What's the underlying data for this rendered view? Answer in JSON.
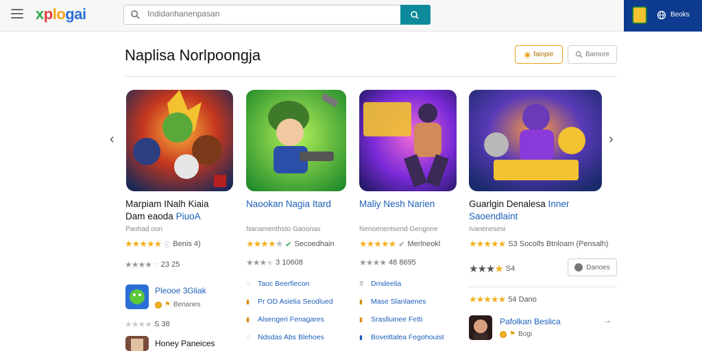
{
  "header": {
    "logo_parts": [
      "x",
      "p",
      "lo",
      "gai"
    ],
    "search_placeholder": "Indidanhanenpasan",
    "account_label": "Beoks"
  },
  "page": {
    "title": "Naplisa Norlpoongja",
    "primary_button": "fainpie",
    "secondary_button": "Bamore"
  },
  "cards": [
    {
      "title_line1": "Marpiam INalh Kiaia",
      "title_line2": "Dam eaoda",
      "title_line2_link": "PiuoA",
      "subtitle": "Paohad oon",
      "rating_text": "Benis 4)",
      "secondary_rating": "23 25",
      "colors": {
        "title": "#111111"
      }
    },
    {
      "title_line1": "Naookan Nagia Itard",
      "subtitle": "Nanamenthsto Gaoonas",
      "rating_text": "Secoedhain",
      "secondary_rating": "3 10608",
      "colors": {
        "title": "#1c5fb8"
      }
    },
    {
      "title_line1": "Maliy Nesh Narien",
      "subtitle": "Nenoenentsend Gengone",
      "rating_text": "Merlneokl",
      "secondary_rating": "48 8695",
      "colors": {
        "title": "#1c5fb8"
      }
    },
    {
      "title_line1": "Guarlgin Denalesa",
      "title_line1_link": "Inner",
      "title_line2": "Saoendlaint",
      "subtitle": "Ivanenesesi",
      "rating_text": "S3 Socolfs Btnloam (Pensalh)",
      "secondary_rating": "S4",
      "side_button": "Danoes"
    }
  ],
  "list_col1": {
    "items": [
      {
        "title": "Pleooe 3Gliak",
        "meta": "Benanes"
      },
      {
        "title": "Honey Paneices"
      }
    ],
    "rating_between": "S 38"
  },
  "list_col2": {
    "links": [
      "Taoc Beerfiecon",
      "Pr OD Asielia Seodlued",
      "Alsengeri Fenagares",
      "Ndsdas Abs Blehoes"
    ]
  },
  "list_col3": {
    "links": [
      "Dmdeelia",
      "Mase Slanlaenes",
      "Sraslluinee Fetti",
      "Boveittalea Fegohouist"
    ]
  },
  "list_col4": {
    "rating_text": "54 Dano",
    "item_title": "Pafolkan Beslica",
    "item_meta": "Bogi"
  },
  "colors": {
    "accent": "#0f8a9a",
    "account_bg": "#0c3b8f",
    "link": "#1c5fb8",
    "star": "#f2b01e"
  }
}
